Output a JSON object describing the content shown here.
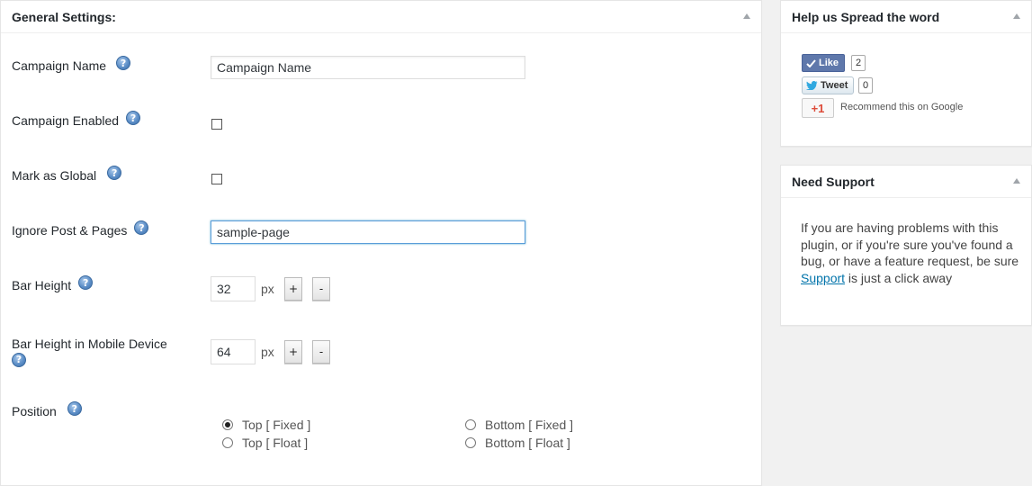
{
  "general": {
    "title": "General Settings:",
    "campaign_name": {
      "label": "Campaign Name",
      "value": "Campaign Name"
    },
    "campaign_enabled": {
      "label": "Campaign Enabled",
      "checked": false
    },
    "mark_global": {
      "label": "Mark as Global",
      "checked": false
    },
    "ignore": {
      "label": "Ignore Post & Pages",
      "value": "sample-page"
    },
    "bar_height": {
      "label": "Bar Height",
      "value": "32",
      "unit": "px",
      "plus": "+",
      "minus": "-"
    },
    "bar_height_mobile": {
      "label": "Bar Height in Mobile Device",
      "value": "64",
      "unit": "px",
      "plus": "+",
      "minus": "-"
    },
    "position": {
      "label": "Position",
      "options": [
        "Top [ Fixed ]",
        "Bottom [ Fixed ]",
        "Top [ Float ]",
        "Bottom [ Float ]"
      ],
      "selected": "Top [ Fixed ]"
    }
  },
  "spread": {
    "title": "Help us Spread the word",
    "like_label": "Like",
    "like_count": "2",
    "tweet_label": "Tweet",
    "tweet_count": "0",
    "gplus_label": "+1",
    "gplus_text": "Recommend this on Google"
  },
  "support": {
    "title": "Need Support",
    "text_before": "If you are having problems with this plugin, or if you're sure you've found a bug, or have a feature request, be sure ",
    "link": "Support",
    "text_after": " is just a click away"
  },
  "colors": {
    "accent": "#0073aa",
    "facebook": "#5f78ab",
    "google": "#dd4b39"
  },
  "icons": [
    "help-icon",
    "collapse-arrow-icon",
    "facebook-like-icon",
    "twitter-bird-icon"
  ]
}
